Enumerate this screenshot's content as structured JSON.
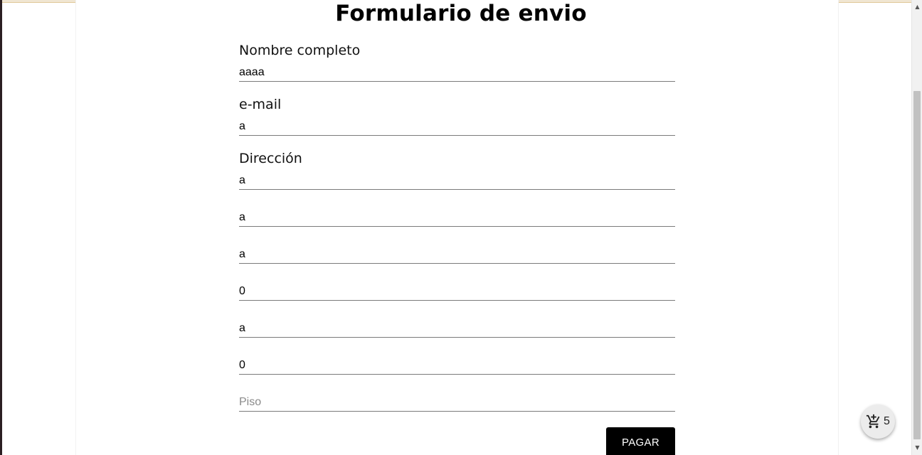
{
  "form": {
    "title": "Formulario de envio",
    "name_label": "Nombre completo",
    "name_value": "aaaa",
    "email_label": "e-mail",
    "email_value": "a",
    "address_label": "Dirección",
    "address_fields": [
      "a",
      "a",
      "a",
      "0",
      "a",
      "0"
    ],
    "piso_placeholder": "Piso",
    "submit_label": "PAGAR"
  },
  "cart": {
    "icon": "cart-add-icon",
    "count": "5"
  }
}
